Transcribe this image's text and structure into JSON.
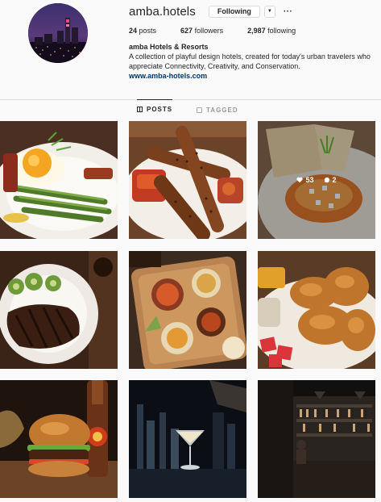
{
  "profile": {
    "username": "amba.hotels",
    "follow_label": "Following",
    "more_label": "···",
    "posts_count": "24",
    "posts_label": "posts",
    "followers_count": "627",
    "followers_label": "followers",
    "following_count": "2,987",
    "following_label": "following",
    "full_name": "amba Hotels & Resorts",
    "bio_text": "A collection of playful design hotels, created for today's urban travelers who appreciate Connectivity, Creativity, and Conservation.",
    "website": "www.amba-hotels.com"
  },
  "tabs": [
    {
      "label": "POSTS",
      "active": true
    },
    {
      "label": "TAGGED",
      "active": false
    }
  ],
  "hovered_post": {
    "likes": "53",
    "comments": "2"
  },
  "posts": [
    {
      "icon": "egg-asparagus-plate"
    },
    {
      "icon": "sausages-plate"
    },
    {
      "icon": "ceviche-bowl"
    },
    {
      "icon": "steak-plate"
    },
    {
      "icon": "appetizer-board"
    },
    {
      "icon": "fried-chicken"
    },
    {
      "icon": "burger"
    },
    {
      "icon": "cocktail-bar"
    },
    {
      "icon": "hotel-bar"
    }
  ],
  "colors": {
    "link": "#003569",
    "border": "#dbdbdb",
    "text": "#262626",
    "muted": "#999999"
  }
}
